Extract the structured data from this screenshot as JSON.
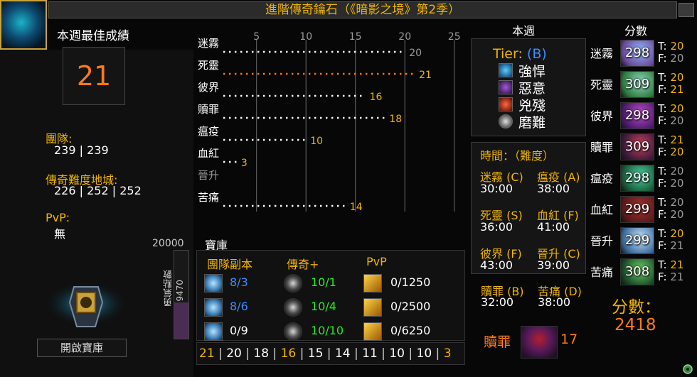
{
  "title": "進階傳奇鑰石（《暗影之境》第2季）",
  "left": {
    "best_label": "本週最佳成績",
    "best_value": "21",
    "raid_label": "團隊:",
    "raid_value": "239 | 239",
    "mythic_label": "傳奇難度地城:",
    "mythic_value": "226 | 252 | 252",
    "pvp_label": "PvP:",
    "pvp_value": "無",
    "valor_max": "20000",
    "valor_label": "勇氣點數",
    "valor_value": "9470",
    "valor_fraction": 0.4735,
    "open_vault": "開啟寶庫"
  },
  "chart_data": {
    "type": "bar",
    "ticks": [
      "5",
      "10",
      "15",
      "20",
      "25"
    ],
    "xlim": [
      2,
      27
    ],
    "categories": [
      "迷霧",
      "死靈",
      "彼界",
      "贖罪",
      "瘟疫",
      "血紅",
      "晉升",
      "苦痛"
    ],
    "values": [
      20,
      21,
      16,
      18,
      10,
      3,
      0,
      14
    ],
    "highlight": "死靈"
  },
  "vault": {
    "title": "寶庫",
    "headers": [
      "團隊副本",
      "傳奇+",
      "PvP"
    ],
    "raid": [
      "8/3",
      "8/6",
      "0/9"
    ],
    "raid_colors": [
      "#3c8cff",
      "#3c8cff",
      "#ffffff"
    ],
    "mythic": [
      "10/1",
      "10/4",
      "10/10"
    ],
    "pvp": [
      "0/1250",
      "0/2500",
      "0/6250"
    ]
  },
  "runs": [
    "21",
    "20",
    "18",
    "16",
    "15",
    "14",
    "11",
    "10",
    "10",
    "3"
  ],
  "runs_colors": [
    "#f0b400",
    "#ffffff",
    "#ffffff",
    "#f0b400",
    "#ffffff",
    "#ffffff",
    "#ffffff",
    "#ffffff",
    "#ffffff",
    "#f0b400"
  ],
  "week": {
    "title": "本週",
    "tier_label": "Tier:",
    "tier_value": "(B)",
    "affixes": [
      "強悍",
      "惡意",
      "兇殘",
      "磨難"
    ]
  },
  "times": {
    "header": "時間：（難度）",
    "entries": [
      {
        "name": "迷霧 (C)",
        "time": "30:00"
      },
      {
        "name": "瘟疫 (A)",
        "time": "38:00"
      },
      {
        "name": "死靈 (S)",
        "time": "36:00"
      },
      {
        "name": "血紅 (F)",
        "time": "41:00"
      },
      {
        "name": "彼界 (F)",
        "time": "43:00"
      },
      {
        "name": "晉升 (C)",
        "time": "39:00"
      },
      {
        "name": "贖罪 (B)",
        "time": "32:00"
      },
      {
        "name": "苦痛 (D)",
        "time": "38:00"
      }
    ]
  },
  "scores": {
    "title": "分數",
    "t_prefix": "T:",
    "f_prefix": "F:",
    "rows": [
      {
        "name": "迷霧",
        "score": "298",
        "t": "20",
        "f": "20",
        "t_color": "#f0b400",
        "f_color": "#9a9a9a",
        "c1": "#6a4a9a",
        "c2": "#8fb7ff"
      },
      {
        "name": "死靈",
        "score": "309",
        "t": "20",
        "f": "21",
        "t_color": "#f0b400",
        "f_color": "#f0b400",
        "c1": "#2e7a3e",
        "c2": "#90d8c0"
      },
      {
        "name": "彼界",
        "score": "298",
        "t": "20",
        "f": "20",
        "t_color": "#f0b400",
        "f_color": "#9a9a9a",
        "c1": "#4a1a6a",
        "c2": "#c04ad0"
      },
      {
        "name": "贖罪",
        "score": "309",
        "t": "21",
        "f": "20",
        "t_color": "#f0b400",
        "f_color": "#f0b400",
        "c1": "#3a1a3a",
        "c2": "#c8405a"
      },
      {
        "name": "瘟疫",
        "score": "298",
        "t": "20",
        "f": "20",
        "t_color": "#9a9a9a",
        "f_color": "#9a9a9a",
        "c1": "#1a5a3a",
        "c2": "#4ad0a0"
      },
      {
        "name": "血紅",
        "score": "299",
        "t": "20",
        "f": "20",
        "t_color": "#9a9a9a",
        "f_color": "#9a9a9a",
        "c1": "#5a1a1a",
        "c2": "#a03030"
      },
      {
        "name": "晉升",
        "score": "299",
        "t": "20",
        "f": "21",
        "t_color": "#f0b400",
        "f_color": "#9a9a9a",
        "c1": "#3a6a9a",
        "c2": "#c8e8ff"
      },
      {
        "name": "苦痛",
        "score": "308",
        "t": "21",
        "f": "21",
        "t_color": "#f0b400",
        "f_color": "#9a9a9a",
        "c1": "#1a4a2a",
        "c2": "#6ad060"
      }
    ]
  },
  "total": {
    "label": "分數：",
    "value": "2418"
  },
  "best_run": {
    "name": "贖罪",
    "level": "17"
  },
  "colors": {
    "gold": "#f0b400",
    "orange": "#ff7a1a",
    "blue": "#3c8cff",
    "green": "#22ee22"
  }
}
